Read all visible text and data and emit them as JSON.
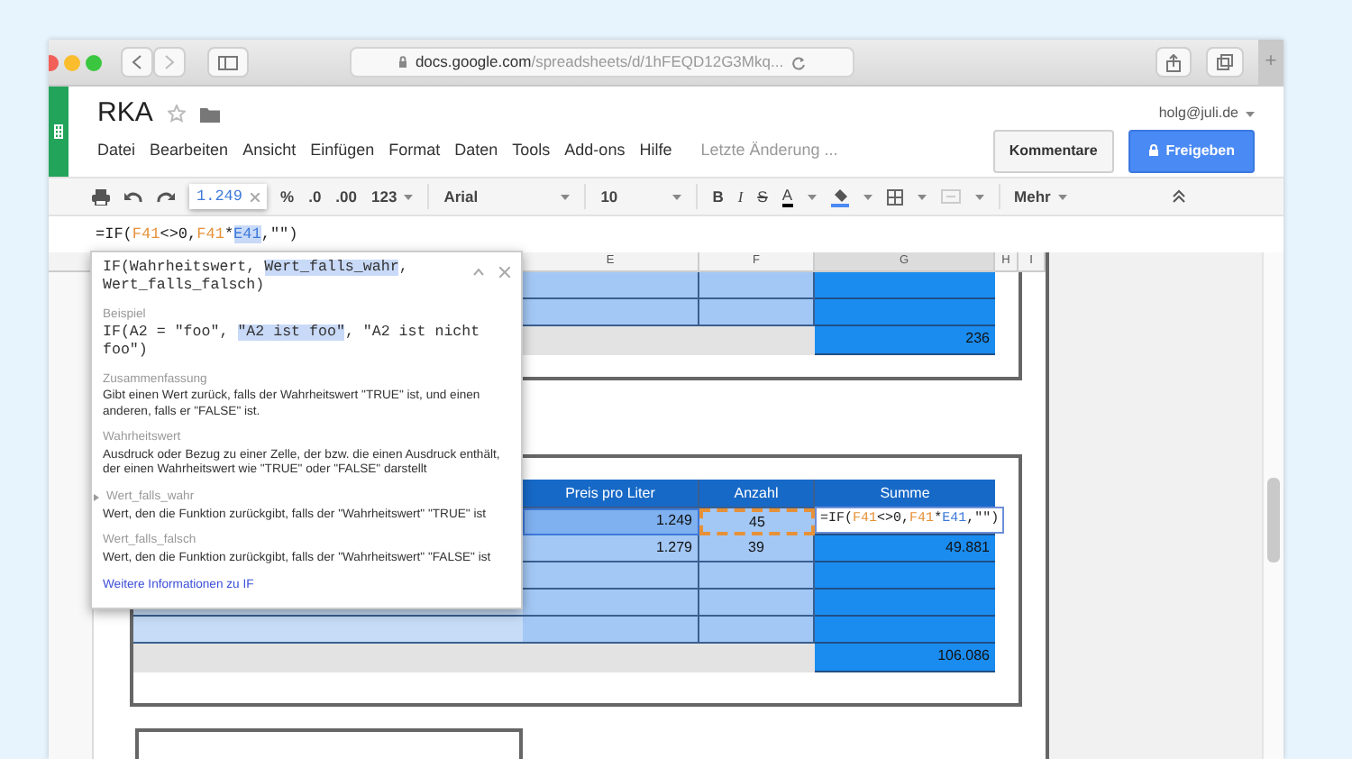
{
  "browser": {
    "url_domain": "docs.google.com",
    "url_path": "/spreadsheets/d/1hFEQD12G3Mkq...",
    "new_tab": "+"
  },
  "header": {
    "title": "RKA",
    "account": "holg@juli.de",
    "menu": [
      "Datei",
      "Bearbeiten",
      "Ansicht",
      "Einfügen",
      "Format",
      "Daten",
      "Tools",
      "Add-ons",
      "Hilfe"
    ],
    "last_edit": "Letzte Änderung ...",
    "buttons": [
      {
        "label": "Kommentare",
        "kind": "secondary"
      },
      {
        "label": "Freigeben",
        "kind": "primary"
      }
    ]
  },
  "toolbar": {
    "number_preview": "1.249",
    "format_items": [
      {
        "label": "%",
        "dropdown": false
      },
      {
        "label": ".0",
        "dropdown": false
      },
      {
        "label": ".00",
        "dropdown": false
      },
      {
        "label": "123",
        "dropdown": true
      }
    ],
    "font": "Arial",
    "size": "10",
    "style_items": [
      {
        "label": "B",
        "kind": "bold"
      },
      {
        "label": "I",
        "kind": "italic"
      },
      {
        "label": "S",
        "kind": "strike"
      },
      {
        "label": "A",
        "kind": "color"
      }
    ],
    "more": "Mehr"
  },
  "formula_bar": {
    "tokens": [
      {
        "text": "=IF(",
        "highlighted": false
      },
      {
        "text": "F41",
        "color": "#e69138",
        "highlighted": false
      },
      {
        "text": "<>0,",
        "highlighted": false
      },
      {
        "text": "F41",
        "color": "#e69138",
        "highlighted": false
      },
      {
        "text": "*",
        "highlighted": false
      },
      {
        "text": "E41",
        "color": "#3c78d8",
        "highlighted": true
      },
      {
        "text": ",\"\")",
        "highlighted": false
      }
    ]
  },
  "columns": [
    {
      "label": "E",
      "selected": false
    },
    {
      "label": "F",
      "selected": false
    },
    {
      "label": "G",
      "selected": true
    },
    {
      "label": "H",
      "selected": false
    },
    {
      "label": "I",
      "selected": false
    }
  ],
  "upper_table": {
    "rows": [
      {
        "kind": "blank"
      },
      {
        "kind": "blank"
      },
      {
        "kind": "total",
        "sum": "236"
      }
    ]
  },
  "lower_table": {
    "headers": [
      "Preis pro Liter",
      "Anzahl",
      "Summe"
    ],
    "rows": [
      {
        "kind": "data",
        "price": {
          "text": "1.249",
          "color": "#3c78d8"
        },
        "count": {
          "text": "45",
          "color": "#e69138"
        },
        "sum": {
          "editing": true,
          "tokens": [
            {
              "text": "=IF(",
              "highlighted": false
            },
            {
              "text": "F41",
              "color": "#e69138",
              "highlighted": false
            },
            {
              "text": "<>0,",
              "highlighted": false
            },
            {
              "text": "F41",
              "color": "#e69138",
              "highlighted": false
            },
            {
              "text": "*",
              "highlighted": false
            },
            {
              "text": "E41",
              "color": "#3c78d8",
              "highlighted": false
            },
            {
              "text": ",\"\")",
              "highlighted": false
            }
          ]
        }
      },
      {
        "kind": "data",
        "price": {
          "text": "1.279"
        },
        "count": {
          "text": "39"
        },
        "sum": {
          "editing": false,
          "text": "49.881"
        }
      },
      {
        "kind": "blank"
      },
      {
        "kind": "blank"
      },
      {
        "kind": "blank"
      }
    ],
    "total": "106.086"
  },
  "popup": {
    "signature": [
      {
        "text": "IF(Wahrheitswert, ",
        "highlighted": false
      },
      {
        "text": "Wert_falls_wahr",
        "highlighted": true
      },
      {
        "text": ", Wert_falls_falsch)",
        "highlighted": false
      }
    ],
    "example_label": "Beispiel",
    "example": [
      {
        "text": "IF(A2 = \"foo\", ",
        "highlighted": false
      },
      {
        "text": "\"A2 ist foo\"",
        "highlighted": true
      },
      {
        "text": ", \"A2 ist nicht foo\")",
        "highlighted": false
      }
    ],
    "sections": [
      {
        "heading": "Zusammenfassung",
        "text": "Gibt einen Wert zurück, falls der Wahrheitswert \"TRUE\" ist, und einen anderen, falls er \"FALSE\" ist.",
        "current": false
      },
      {
        "heading": "Wahrheitswert",
        "text": "Ausdruck oder Bezug zu einer Zelle, der bzw. die einen Ausdruck enthält, der einen Wahrheitswert wie \"TRUE\" oder \"FALSE\" darstellt",
        "current": false
      },
      {
        "heading": "Wert_falls_wahr",
        "text": "Wert, den die Funktion zurückgibt, falls der \"Wahrheitswert\" \"TRUE\" ist",
        "current": true
      },
      {
        "heading": "Wert_falls_falsch",
        "text": "Wert, den die Funktion zurückgibt, falls der \"Wahrheitswert\" \"FALSE\" ist",
        "current": false
      }
    ],
    "link": "Weitere Informationen zu IF"
  }
}
